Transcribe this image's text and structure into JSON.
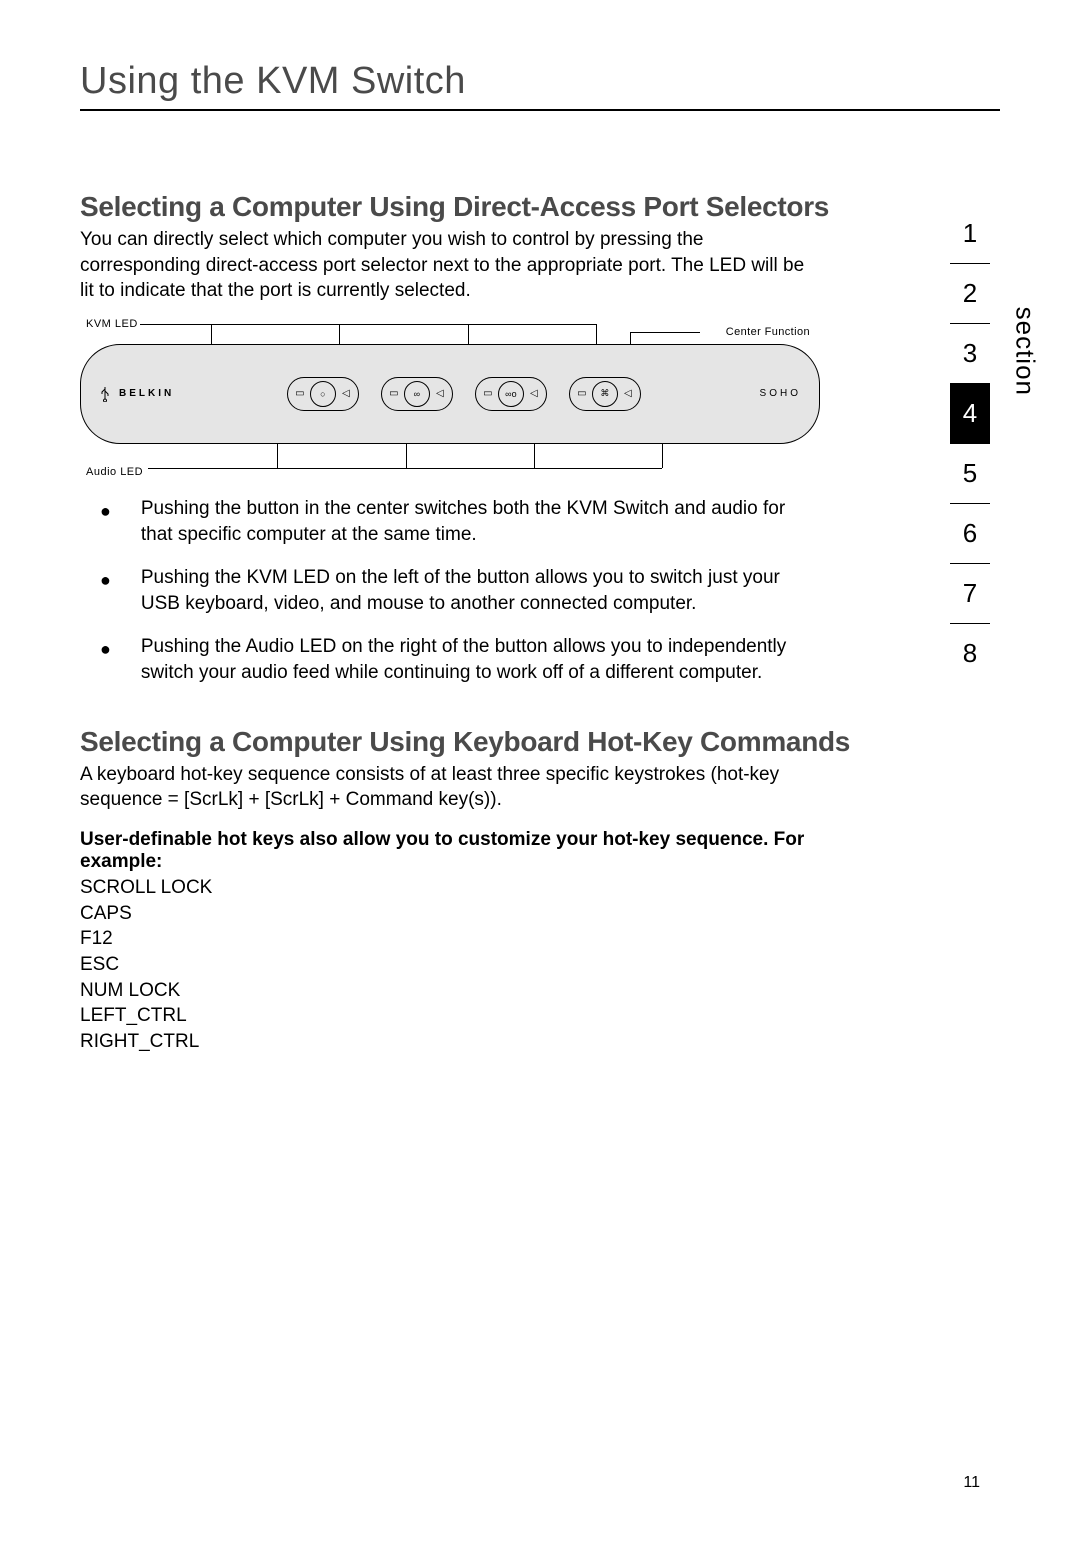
{
  "title": "Using the KVM Switch",
  "subhead1": "Selecting a Computer Using Direct-Access Port Selectors",
  "intro1": "You can directly select which computer you wish to control by pressing the corresponding direct-access port selector next to the appropriate port. The LED will be lit to indicate that the port is currently selected.",
  "diagram": {
    "kvm_led": "KVM LED",
    "center_function": "Center Function",
    "audio_led": "Audio LED",
    "brand": "BELKIN",
    "soho": "SOHO"
  },
  "bullets": [
    "Pushing the button in the center switches both the KVM Switch and audio for that specific computer at the same time.",
    "Pushing the KVM LED on the left of the button allows you to switch just your USB keyboard, video, and mouse to another connected computer.",
    "Pushing the Audio LED on the right of the button allows you to independently switch your audio feed while continuing to work off of a different computer."
  ],
  "subhead2": "Selecting a Computer Using Keyboard Hot-Key Commands",
  "intro2": "A keyboard hot-key sequence consists of at least three specific keystrokes (hot-key sequence = [ScrLk] + [ScrLk] + Command key(s)).",
  "bold_line": "User-definable hot keys also allow you to customize your hot-key sequence. For example:",
  "hotkeys": [
    "SCROLL LOCK",
    "CAPS",
    "F12",
    "ESC",
    "NUM LOCK",
    "LEFT_CTRL",
    "RIGHT_CTRL"
  ],
  "section_label": "section",
  "sections": [
    "1",
    "2",
    "3",
    "4",
    "5",
    "6",
    "7",
    "8"
  ],
  "active_section": "4",
  "page_number": "11"
}
